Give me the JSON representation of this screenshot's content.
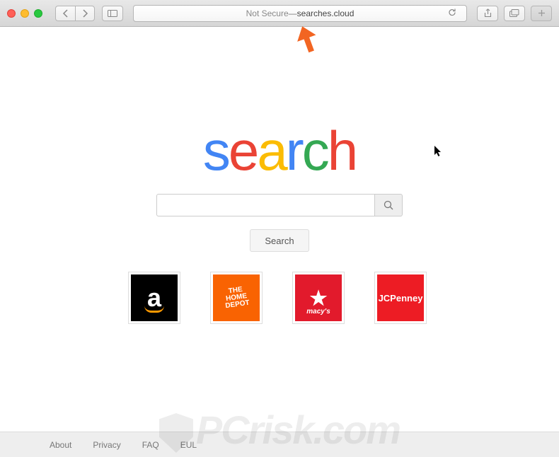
{
  "browser": {
    "address_secure": "Not Secure",
    "address_separator": " — ",
    "address_domain": "searches.cloud"
  },
  "logo": {
    "letters": [
      {
        "char": "s",
        "color": "#4285F4"
      },
      {
        "char": "e",
        "color": "#EA4335"
      },
      {
        "char": "a",
        "color": "#FBBC05"
      },
      {
        "char": "r",
        "color": "#4285F4"
      },
      {
        "char": "c",
        "color": "#34A853"
      },
      {
        "char": "h",
        "color": "#EA4335"
      }
    ]
  },
  "search": {
    "placeholder": "",
    "button_label": "Search"
  },
  "tiles": [
    {
      "name": "Amazon",
      "style": "amazon",
      "text": "a"
    },
    {
      "name": "The Home Depot",
      "style": "hd",
      "text": "THE HOME DEPOT"
    },
    {
      "name": "Macy's",
      "style": "macys",
      "text": "macy's"
    },
    {
      "name": "JCPenney",
      "style": "jcp",
      "text": "JCPenney"
    }
  ],
  "footer": {
    "links": [
      "About",
      "Privacy",
      "FAQ",
      "EUL"
    ]
  },
  "watermark": "PCrisk.com"
}
